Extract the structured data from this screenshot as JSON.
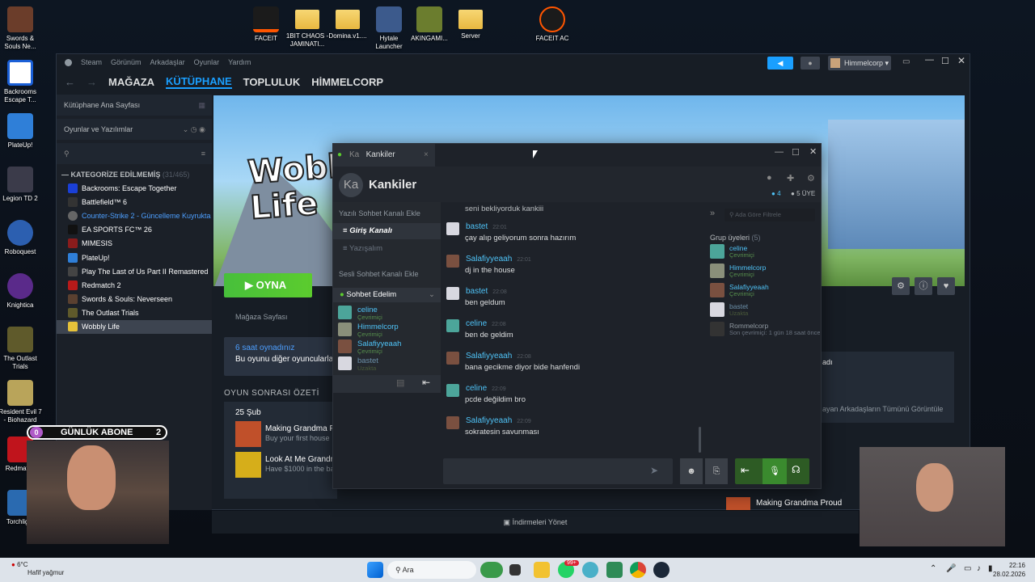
{
  "desktop_icons": [
    {
      "label": "Swords & Souls Ne...",
      "name": "swords-souls"
    },
    {
      "label": "Backrooms Escape T...",
      "name": "backrooms"
    },
    {
      "label": "PlateUp!",
      "name": "plateup"
    },
    {
      "label": "Legion TD 2",
      "name": "legion-td"
    },
    {
      "label": "Roboquest",
      "name": "roboquest"
    },
    {
      "label": "Knightica",
      "name": "knightica"
    },
    {
      "label": "The Outlast Trials",
      "name": "outlast"
    },
    {
      "label": "Resident Evil 7 - Biohazard",
      "name": "re7"
    },
    {
      "label": "Redmatch",
      "name": "redmatch"
    },
    {
      "label": "Torchlight",
      "name": "torchlight"
    }
  ],
  "top_icons": [
    {
      "label": "FACEIT"
    },
    {
      "label": "1BIT CHAOS - JAMINATI..."
    },
    {
      "label": "Domina.v1...."
    },
    {
      "label": "Hytale Launcher"
    },
    {
      "label": "AKINGAMI..."
    },
    {
      "label": "Server"
    },
    {
      "label": "FACEIT AC"
    }
  ],
  "steam": {
    "menu": [
      "Steam",
      "Görünüm",
      "Arkadaşlar",
      "Oyunlar",
      "Yardım"
    ],
    "nav": [
      "MAĞAZA",
      "KÜTÜPHANE",
      "TOPLULUK",
      "HİMMELCORP"
    ],
    "user": "Himmelcorp",
    "sidebar_home": "Kütüphane Ana Sayfası",
    "filter": "Oyunlar ve Yazılımlar",
    "category": "KATEGORİZE EDİLMEMİŞ",
    "category_count": "(31/465)",
    "games": [
      "Backrooms: Escape Together",
      "Battlefield™ 6",
      "Counter-Strike 2 - Güncelleme Kuyrukta",
      "EA SPORTS FC™ 26",
      "MIMESIS",
      "PlateUp!",
      "Play The Last of Us Part II Remastered",
      "Redmatch 2",
      "Swords & Souls: Neverseen",
      "The Outlast Trials",
      "Wobbly Life"
    ],
    "game_title": "Wobbly Life",
    "play": "OYNA",
    "store_page": "Mağaza Sayfası",
    "played_hours": "6 saat oynadınız",
    "played_desc": "Bu oyunu diğer oyuncularla",
    "post_game": "OYUN SONRASI ÖZETİ",
    "date": "25 Şub",
    "achievements": [
      {
        "title": "Making Grandma Pr",
        "desc": "Buy your first house"
      },
      {
        "title": "Look At Me Grandm",
        "desc": "Have $1000 in the bank"
      }
    ],
    "right_frag_1": "adı",
    "right_frag_2": "ayan Arkadaşların Tümünü Görüntüle",
    "right_ach": "Making Grandma Proud",
    "downloads": "İndirmeleri Yönet"
  },
  "chat": {
    "tab": "Kankiler",
    "tab_short": "Ka",
    "group_name": "Kankiler",
    "online_count": "4",
    "member_count": "5 ÜYE",
    "text_channel_add": "Yazılı Sohbet Kanalı Ekle",
    "channels": [
      "Giriş Kanalı",
      "Yazışalım"
    ],
    "voice_channel_add": "Sesli Sohbet Kanalı Ekle",
    "voice_channel": "Sohbet Edelim",
    "voice_members": [
      {
        "name": "celine",
        "status": "Çevrimiçi"
      },
      {
        "name": "Himmelcorp",
        "status": "Çevrimiçi"
      },
      {
        "name": "Salafiyyeaah",
        "status": "Çevrimiçi"
      },
      {
        "name": "bastet",
        "status": "Uzakta"
      }
    ],
    "first_line": "seni bekliyorduk kankiii",
    "messages": [
      {
        "name": "bastet",
        "time": "22:01",
        "text": "çay alıp geliyorum sonra hazırım"
      },
      {
        "name": "Salafiyyeaah",
        "time": "22:01",
        "text": "dj in the house"
      },
      {
        "name": "bastet",
        "time": "22:08",
        "text": "ben geldum"
      },
      {
        "name": "celine",
        "time": "22:08",
        "text": "ben de geldim"
      },
      {
        "name": "Salafiyyeaah",
        "time": "22:08",
        "text": "bana gecikme diyor bide hanfendi"
      },
      {
        "name": "celine",
        "time": "22:09",
        "text": "pcde değildim bro"
      },
      {
        "name": "Salafiyyeaah",
        "time": "22:09",
        "text": "sokratesin savunması"
      }
    ],
    "search_placeholder": "Ada Göre Filtrele",
    "group_members_label": "Grup üyeleri",
    "group_members_count": "(5)",
    "members": [
      {
        "name": "celine",
        "status": "Çevrimiçi"
      },
      {
        "name": "Himmelcorp",
        "status": "Çevrimiçi"
      },
      {
        "name": "Salafiyyeaah",
        "status": "Çevrimiçi"
      },
      {
        "name": "bastet",
        "status": "Uzakta"
      },
      {
        "name": "Rommelcorp",
        "status": "Son çevrimiçi: 1 gün 18 saat önce"
      }
    ]
  },
  "overlay": {
    "sub_label": "GÜNLÜK ABONE",
    "sub_left": "0",
    "sub_right": "2"
  },
  "taskbar": {
    "weather_temp": "6°C",
    "weather_desc": "Hafif yağmur",
    "search": "Ara",
    "time": "22:16",
    "date": "28.02.2026",
    "badge": "99+"
  },
  "colors": {
    "accent": "#1a9fff",
    "play": "#5ccc2e",
    "online": "#57904d",
    "friend": "#4fc3f7"
  }
}
